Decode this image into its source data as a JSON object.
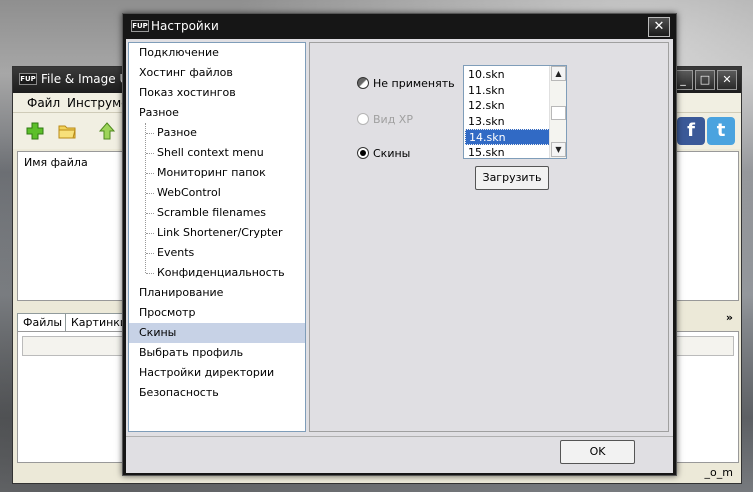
{
  "main_window": {
    "title": "File & Image Up",
    "menu": [
      "Файл",
      "Инструме"
    ],
    "file_list_header": "Имя файла",
    "tabs": [
      "Файлы",
      "Картинки"
    ],
    "status_text": "_o_m",
    "icons": [
      "plus-icon",
      "folder-icon",
      "up-arrow-icon",
      "facebook-icon",
      "twitter-icon"
    ],
    "social": {
      "facebook": "f",
      "twitter": "t"
    },
    "controls": {
      "minimize": "_",
      "maximize": "□",
      "close": "✕"
    }
  },
  "dialog": {
    "icon_text": "FUP",
    "title": "Настройки",
    "close_glyph": "✕",
    "tree": [
      {
        "label": "Подключение",
        "level": 0
      },
      {
        "label": "Хостинг файлов",
        "level": 0
      },
      {
        "label": "Показ хостингов",
        "level": 0
      },
      {
        "label": "Разное",
        "level": 0
      },
      {
        "label": "Разное",
        "level": 1
      },
      {
        "label": "Shell context menu",
        "level": 1
      },
      {
        "label": "Мониторинг папок",
        "level": 1
      },
      {
        "label": "WebControl",
        "level": 1
      },
      {
        "label": "Scramble filenames",
        "level": 1
      },
      {
        "label": "Link Shortener/Crypter",
        "level": 1
      },
      {
        "label": "Events",
        "level": 1
      },
      {
        "label": "Конфиденциальность",
        "level": 1
      },
      {
        "label": "Планирование",
        "level": 0
      },
      {
        "label": "Просмотр",
        "level": 0
      },
      {
        "label": "Скины",
        "level": 0,
        "selected": true
      },
      {
        "label": "Выбрать профиль",
        "level": 0
      },
      {
        "label": "Настройки директории",
        "level": 0
      },
      {
        "label": "Безопасность",
        "level": 0
      }
    ],
    "radios": [
      {
        "label": "Не применять",
        "state": "indeterminate",
        "enabled": true
      },
      {
        "label": "Вид XP",
        "state": "off",
        "enabled": false
      },
      {
        "label": "Скины",
        "state": "on",
        "enabled": true
      }
    ],
    "skin_list": [
      "10.skn",
      "11.skn",
      "12.skn",
      "13.skn",
      "14.skn",
      "15.skn"
    ],
    "skin_selected": "14.skn",
    "load_button": "Загрузить",
    "ok_button": "OK"
  },
  "colors": {
    "selection": "#316ac5",
    "tree_selection": "#c7d2e6",
    "dialog_face": "#e0dfe3",
    "titlebar": "#161616"
  }
}
